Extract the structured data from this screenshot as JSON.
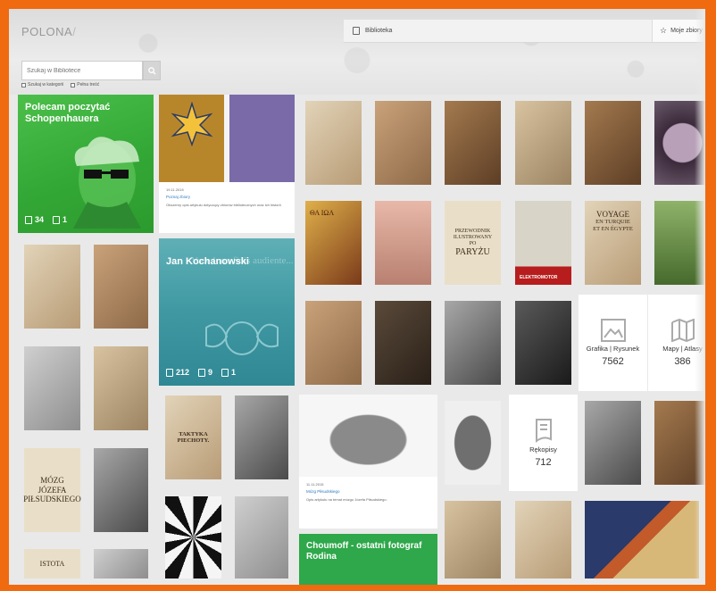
{
  "header": {
    "logo": "POLONA",
    "logo_slash": "/",
    "library_tab": "Biblioteka",
    "favorites_tab": "Moje zbiory",
    "search_placeholder": "Szukaj w Bibliotece",
    "filter_1": "Szukaj w kategorii",
    "filter_2": "Pełna treść"
  },
  "colors": {
    "border": "#f06a10",
    "green": "#33a836",
    "teal": "#3f98a2",
    "link": "#2a7bbf"
  },
  "cards": {
    "schopenhauer": {
      "title": "Polecam poczytać Schopenhauera",
      "books": "34",
      "images": "1"
    },
    "kochanowski": {
      "title": "Jan Kochanowski",
      "books": "212",
      "images": "9",
      "magazines": "1",
      "background_text": "Voce lono fidis audiente..."
    },
    "article_1": {
      "date": "19.11.2015",
      "title": "Poznaj zbiory",
      "body": "Obszerny opis artykułu dotyczący zbiorów bibliotecznych oraz ich historii."
    },
    "article_2": {
      "date": "11.11.2015",
      "title": "Mózg Piłsudskiego",
      "body": "Opis artykułu na temat mózgu Józefa Piłsudskiego."
    },
    "choumoff": {
      "title": "Choumoff - ostatni fotograf Rodina"
    }
  },
  "categories": [
    {
      "name": "Grafika | Rysunek",
      "count": "7562",
      "icon": "image-icon"
    },
    {
      "name": "Mapy | Atlasy",
      "count": "386",
      "icon": "map-icon"
    },
    {
      "name": "Rękopisy",
      "count": "712",
      "icon": "manuscript-icon"
    }
  ],
  "book_covers": {
    "paryz": [
      "PRZEWODNIK",
      "ILUSTROWANY",
      "PO",
      "PARYŻU"
    ],
    "elektromotor": "ELEKTROMOTOR",
    "voyage": [
      "VOYAGE",
      "EN TURQUIE",
      "ET EN ÉGYPTE"
    ],
    "taktyka": "TAKTYKA PIECHOTY.",
    "mozg": [
      "MÓZG",
      "JÓZEFA",
      "PIŁSUDSKIEGO"
    ],
    "istota": "ISTOTA",
    "icon_title": "ΘΑ ΙΩΑ"
  }
}
